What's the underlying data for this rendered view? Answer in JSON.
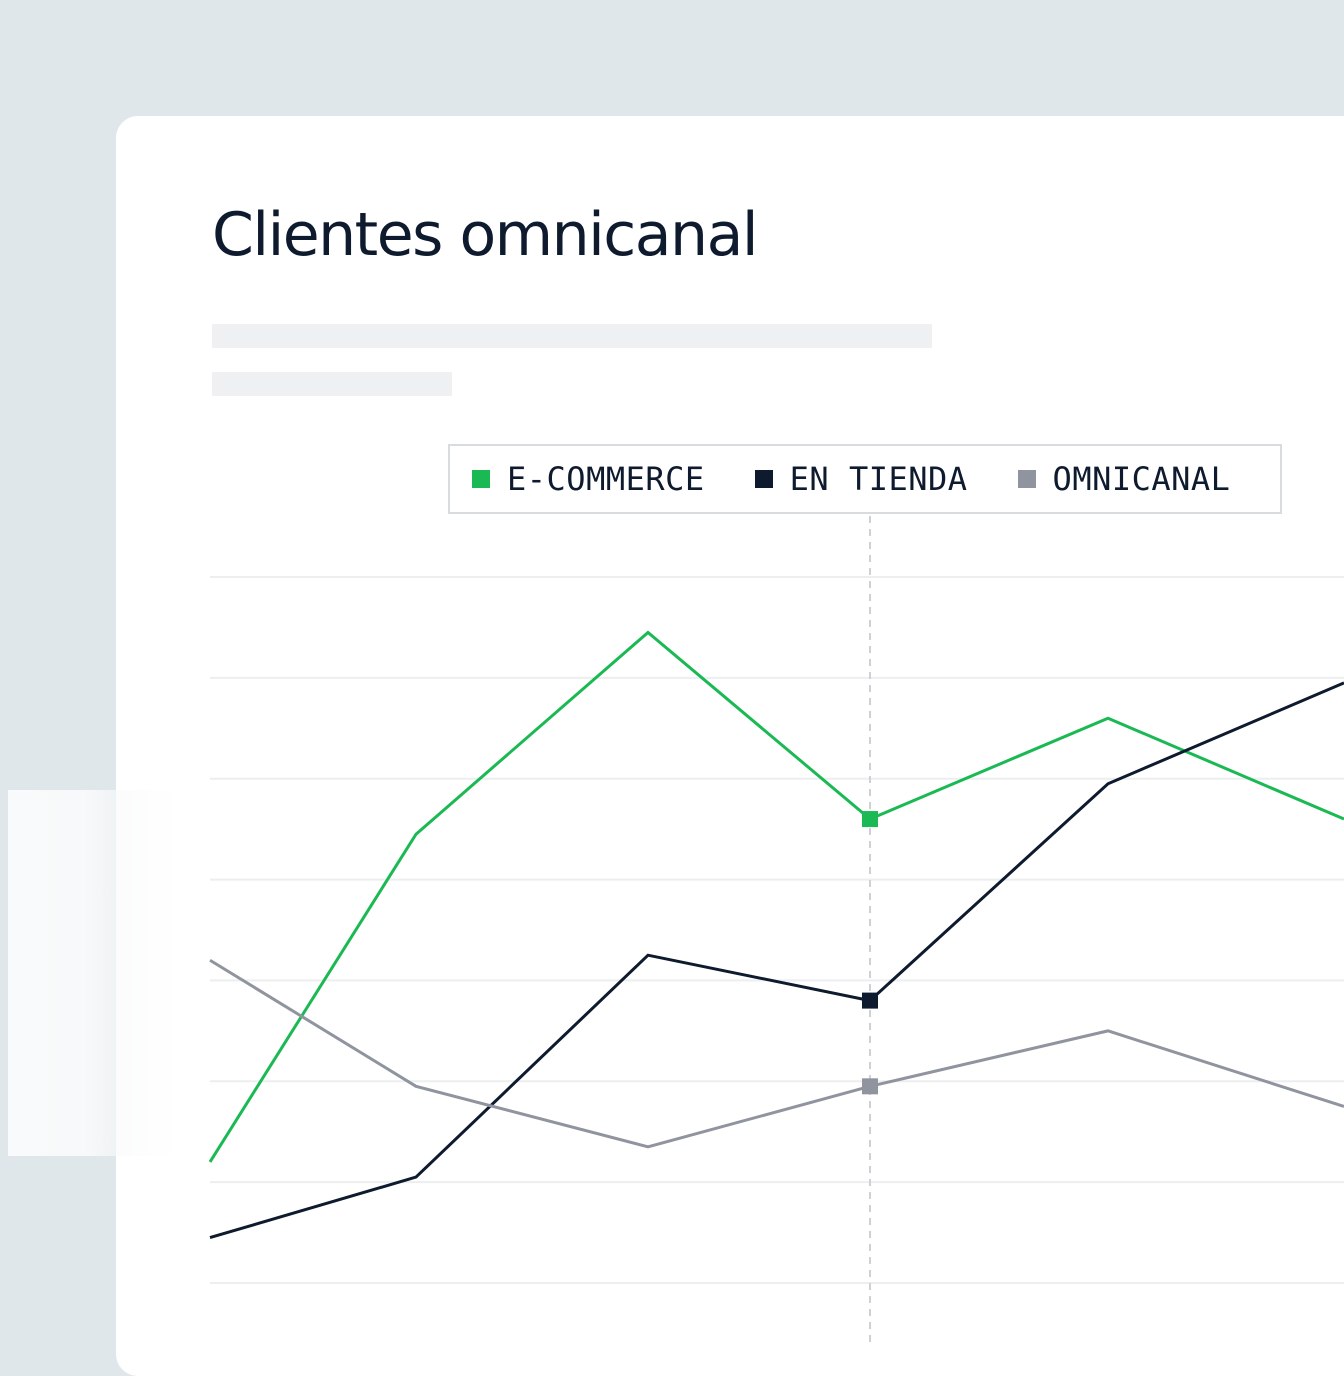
{
  "title": "Clientes omnicanal",
  "colors": {
    "background": "#e0e7ea",
    "ecommerce": "#1bb954",
    "en_tienda": "#0e1a2e",
    "omnicanal": "#8f949e",
    "grid": "#eceef0",
    "crosshair": "#cfd2d5"
  },
  "legend": {
    "items": [
      {
        "label": "E-COMMERCE",
        "color": "#1bb954"
      },
      {
        "label": "EN TIENDA",
        "color": "#0e1a2e"
      },
      {
        "label": "OMNICANAL",
        "color": "#8f949e"
      }
    ],
    "placement": "top"
  },
  "chart_data": {
    "type": "line",
    "title": "Clientes omnicanal",
    "xlabel": "",
    "ylabel": "",
    "grid": true,
    "x": [
      0,
      1,
      2,
      3,
      4,
      5
    ],
    "ylim": [
      0,
      7
    ],
    "highlight_index": 3,
    "series": [
      {
        "name": "E-COMMERCE",
        "values": [
          1.2,
          4.45,
          6.45,
          4.6,
          5.6,
          4.6
        ]
      },
      {
        "name": "EN TIENDA",
        "values": [
          0.45,
          1.05,
          3.25,
          2.8,
          4.95,
          5.95
        ]
      },
      {
        "name": "OMNICANAL",
        "values": [
          3.2,
          1.95,
          1.35,
          1.95,
          2.5,
          1.75
        ]
      }
    ]
  }
}
